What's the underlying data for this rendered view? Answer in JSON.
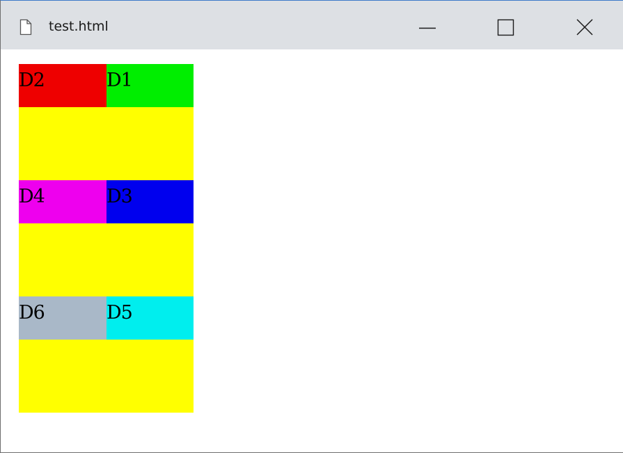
{
  "window": {
    "title": "test.html",
    "controls": {
      "minimize": "minimize",
      "maximize": "maximize",
      "close": "close"
    }
  },
  "rows": [
    {
      "left": {
        "label": "D2",
        "color": "#ee0000"
      },
      "right": {
        "label": "D1",
        "color": "#00ee00"
      }
    },
    {
      "left": {
        "label": "D4",
        "color": "#ee00ee"
      },
      "right": {
        "label": "D3",
        "color": "#0000ee"
      }
    },
    {
      "left": {
        "label": "D6",
        "color": "#a9b8c8"
      },
      "right": {
        "label": "D5",
        "color": "#00eeee"
      }
    }
  ],
  "colors": {
    "container_background": "#ffff00",
    "titlebar": "#dde0e4"
  }
}
